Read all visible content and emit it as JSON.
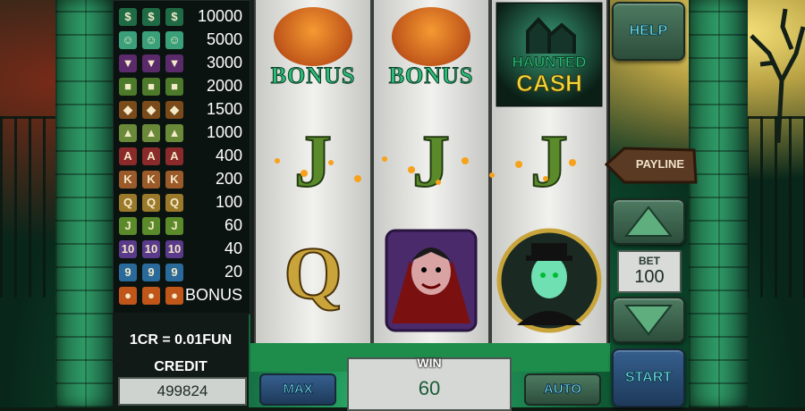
{
  "paytable": [
    {
      "symbol": "haunted-cash",
      "payout": "10000",
      "glyph": "$",
      "color": "#1f6b45"
    },
    {
      "symbol": "ghost-man",
      "payout": "5000",
      "glyph": "☺",
      "color": "#3aa07a"
    },
    {
      "symbol": "vampire",
      "payout": "3000",
      "glyph": "▼",
      "color": "#5a2a6a"
    },
    {
      "symbol": "frankenstein",
      "payout": "2000",
      "glyph": "■",
      "color": "#4c7a2a"
    },
    {
      "symbol": "werewolf",
      "payout": "1500",
      "glyph": "◆",
      "color": "#7a4a1a"
    },
    {
      "symbol": "witch",
      "payout": "1000",
      "glyph": "▲",
      "color": "#6a8a3a"
    },
    {
      "symbol": "A",
      "payout": "400",
      "glyph": "A",
      "color": "#8a2a2a"
    },
    {
      "symbol": "K",
      "payout": "200",
      "glyph": "K",
      "color": "#9a5a2a"
    },
    {
      "symbol": "Q",
      "payout": "100",
      "glyph": "Q",
      "color": "#9a7a2a"
    },
    {
      "symbol": "J",
      "payout": "60",
      "glyph": "J",
      "color": "#5a8a2a"
    },
    {
      "symbol": "10",
      "payout": "40",
      "glyph": "10",
      "color": "#5a3a8a"
    },
    {
      "symbol": "9",
      "payout": "20",
      "glyph": "9",
      "color": "#2a6a9a"
    },
    {
      "symbol": "bonus-pumpkin",
      "payout": "BONUS",
      "glyph": "●",
      "color": "#c0561a"
    }
  ],
  "reels": [
    [
      {
        "type": "bonus",
        "text": "BONUS"
      },
      {
        "type": "letter",
        "text": "J"
      },
      {
        "type": "letter",
        "text": "Q"
      }
    ],
    [
      {
        "type": "bonus",
        "text": "BONUS"
      },
      {
        "type": "letter",
        "text": "J"
      },
      {
        "type": "vampire",
        "text": ""
      }
    ],
    [
      {
        "type": "haunted-cash",
        "text": "HAUNTED CASH"
      },
      {
        "type": "letter",
        "text": "J"
      },
      {
        "type": "ghost",
        "text": ""
      }
    ]
  ],
  "reel_labels": {
    "haunted": "HAUNTED",
    "cash": "CASH"
  },
  "buttons": {
    "help": "HELP",
    "payline": "PAYLINE",
    "max": "MAX",
    "auto": "AUTO",
    "start": "START"
  },
  "bet": {
    "label": "BET",
    "value": "100"
  },
  "credit": {
    "ratio": "1CR = 0.01FUN",
    "label": "CREDIT",
    "value": "499824"
  },
  "win": {
    "label": "WIN",
    "value": "60"
  },
  "colors": {
    "accent_green": "#1e8c4a",
    "button_text": "#7ef0f6",
    "reel_bg": "#f1f1ee",
    "bonus_text": "#2bbd78"
  }
}
